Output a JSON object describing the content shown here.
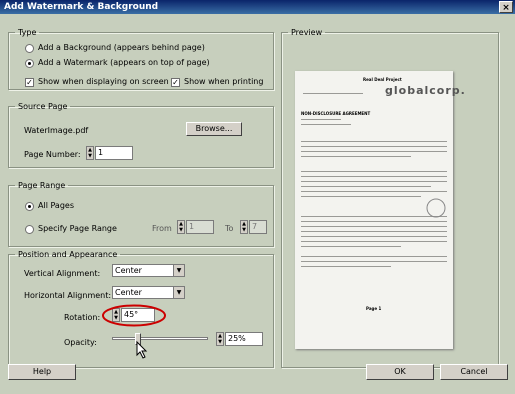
{
  "window": {
    "title": "Add Watermark & Background",
    "close_glyph": "×"
  },
  "type_group": {
    "legend": "Type",
    "add_background": "Add a Background (appears behind page)",
    "add_watermark": "Add a Watermark (appears on top of page)",
    "show_on_screen": "Show when displaying on screen",
    "show_printing": "Show when printing",
    "check_mark": "✓"
  },
  "source_group": {
    "legend": "Source Page",
    "filename": "WaterImage.pdf",
    "browse": "Browse...",
    "page_number_label": "Page Number:",
    "page_number_value": "1"
  },
  "range_group": {
    "legend": "Page Range",
    "all_pages": "All Pages",
    "specify": "Specify Page Range",
    "from_label": "From",
    "from_value": "1",
    "to_label": "To",
    "to_value": "7"
  },
  "position_group": {
    "legend": "Position and Appearance",
    "vertical_label": "Vertical Alignment:",
    "vertical_value": "Center",
    "horizontal_label": "Horizontal Alignment:",
    "horizontal_value": "Center",
    "rotation_label": "Rotation:",
    "rotation_value": "45°",
    "opacity_label": "Opacity:",
    "opacity_value": "25%",
    "opacity_fraction": 0.25
  },
  "preview": {
    "legend": "Preview",
    "doc_header": "Real Deal Project",
    "logo": "globalcorp.",
    "doc_heading": "NON-DISCLOSURE AGREEMENT",
    "footer": "Page 1"
  },
  "buttons": {
    "help": "Help",
    "ok": "OK",
    "cancel": "Cancel"
  },
  "colors": {
    "highlight_ellipse": "#cc0000",
    "titlebar": "#0a246a",
    "panel": "#c7cfbd"
  }
}
